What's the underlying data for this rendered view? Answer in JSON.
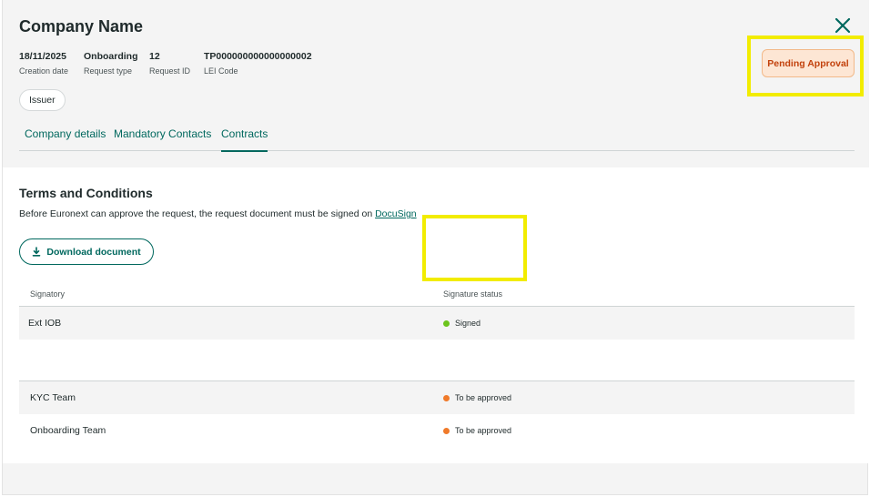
{
  "header": {
    "company_name": "Company Name",
    "meta": [
      {
        "value": "18/11/2025",
        "label": "Creation date"
      },
      {
        "value": "Onboarding",
        "label": "Request type"
      },
      {
        "value": "12",
        "label": "Request ID"
      },
      {
        "value": "TP000000000000000002",
        "label": "LEI Code"
      }
    ],
    "role": "Issuer",
    "status": "Pending Approval"
  },
  "tabs": [
    {
      "label": "Company details",
      "active": false
    },
    {
      "label": "Mandatory Contacts",
      "active": false
    },
    {
      "label": "Contracts",
      "active": true
    }
  ],
  "terms": {
    "title": "Terms and Conditions",
    "description": "Before Euronext can approve the request, the request document must be signed on ",
    "link": "DocuSign",
    "download_label": "Download document"
  },
  "table": {
    "headers": {
      "signatory": "Signatory",
      "status": "Signature status"
    },
    "rows": [
      {
        "name": "Ext IOB",
        "status": "Signed"
      },
      {
        "name": "KYC Team",
        "status": "To be approved"
      },
      {
        "name": "Onboarding Team",
        "status": "To be approved"
      }
    ]
  },
  "colors": {
    "accent": "#00685e",
    "signed": "#6cc41c",
    "pending": "#f07a2a",
    "status_bg": "#fde6d4",
    "status_text": "#c2410c",
    "highlight": "#f2ec00"
  },
  "icons": {
    "close": "close-icon",
    "download": "download-icon"
  }
}
